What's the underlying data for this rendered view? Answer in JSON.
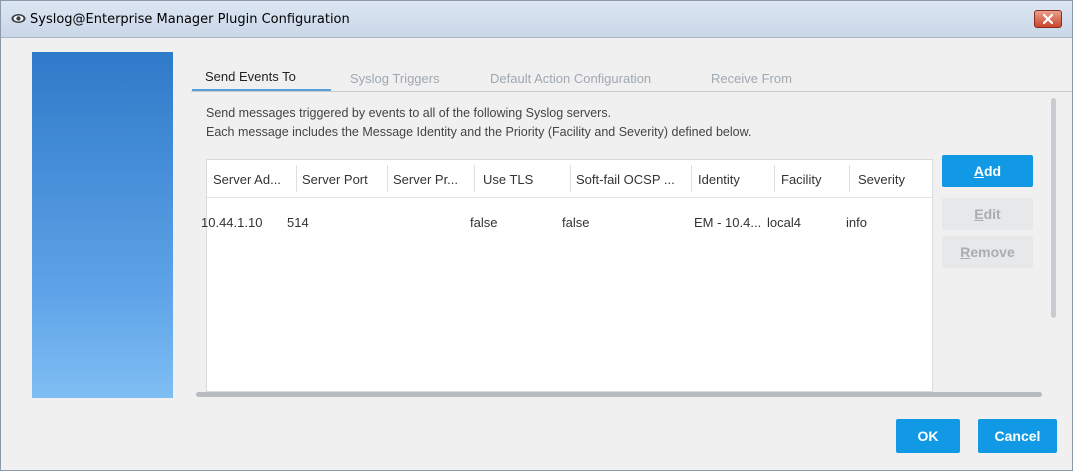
{
  "window": {
    "title": "Syslog@Enterprise Manager Plugin Configuration"
  },
  "tabs": [
    {
      "label": "Send Events To",
      "active": true
    },
    {
      "label": "Syslog Triggers",
      "active": false
    },
    {
      "label": "Default Action Configuration",
      "active": false
    },
    {
      "label": "Receive From",
      "active": false
    }
  ],
  "description": {
    "line1": "Send messages triggered by events to all of the following Syslog servers.",
    "line2": "Each message includes the Message Identity and the Priority (Facility and Severity) defined below."
  },
  "table": {
    "columns": [
      "Server Ad...",
      "Server Port",
      "Server Pr...",
      "Use TLS",
      "Soft-fail OCSP ...",
      "Identity",
      "Facility",
      "Severity"
    ],
    "rows": [
      [
        "10.44.1.10",
        "514",
        "",
        "false",
        "false",
        "EM - 10.4...",
        "local4",
        "info"
      ]
    ]
  },
  "buttons": {
    "add": {
      "first": "A",
      "rest": "dd"
    },
    "edit": {
      "first": "E",
      "rest": "dit"
    },
    "remove": {
      "first": "R",
      "rest": "emove"
    },
    "ok": "OK",
    "cancel": "Cancel"
  },
  "colors": {
    "accent": "#1199e5",
    "active_tab_indicator": "#5aa0d8",
    "side_panel_top": "#2f7ac9",
    "side_panel_bottom": "#7fbef3"
  },
  "icons": {
    "title": "eye-icon",
    "close": "close-icon"
  }
}
